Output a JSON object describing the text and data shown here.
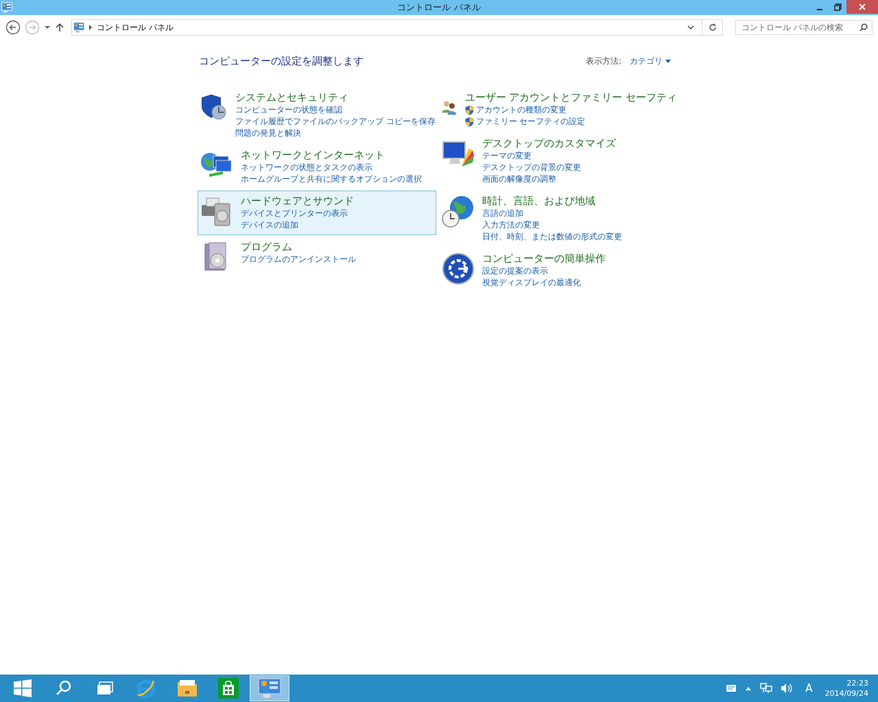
{
  "window": {
    "title": "コントロール パネル"
  },
  "address_bar": {
    "path": "コントロール パネル"
  },
  "search": {
    "placeholder": "コントロール パネルの検索"
  },
  "heading": "コンピューターの設定を調整します",
  "view_by": {
    "label": "表示方法:",
    "value": "カテゴリ"
  },
  "columns": [
    {
      "categories": [
        {
          "kind": "security",
          "title": "システムとセキュリティ",
          "highlighted": false,
          "links": [
            {
              "text": "コンピューターの状態を確認",
              "shield": false
            },
            {
              "text": "ファイル履歴でファイルのバックアップ コピーを保存",
              "shield": false
            },
            {
              "text": "問題の発見と解決",
              "shield": false
            }
          ]
        },
        {
          "kind": "network",
          "title": "ネットワークとインターネット",
          "highlighted": false,
          "links": [
            {
              "text": "ネットワークの状態とタスクの表示",
              "shield": false
            },
            {
              "text": "ホームグループと共有に関するオプションの選択",
              "shield": false
            }
          ]
        },
        {
          "kind": "hardware",
          "title": "ハードウェアとサウンド",
          "highlighted": true,
          "links": [
            {
              "text": "デバイスとプリンターの表示",
              "shield": false
            },
            {
              "text": "デバイスの追加",
              "shield": false
            }
          ]
        },
        {
          "kind": "programs",
          "title": "プログラム",
          "highlighted": false,
          "links": [
            {
              "text": "プログラムのアンインストール",
              "shield": false
            }
          ]
        }
      ]
    },
    {
      "categories": [
        {
          "kind": "users",
          "title": "ユーザー アカウントとファミリー セーフティ",
          "highlighted": false,
          "links": [
            {
              "text": "アカウントの種類の変更",
              "shield": true
            },
            {
              "text": "ファミリー セーフティの設定",
              "shield": true
            }
          ]
        },
        {
          "kind": "appearance",
          "title": "デスクトップのカスタマイズ",
          "highlighted": false,
          "links": [
            {
              "text": "テーマの変更",
              "shield": false
            },
            {
              "text": "デスクトップの背景の変更",
              "shield": false
            },
            {
              "text": "画面の解像度の調整",
              "shield": false
            }
          ]
        },
        {
          "kind": "clock",
          "title": "時計、言語、および地域",
          "highlighted": false,
          "links": [
            {
              "text": "言語の追加",
              "shield": false
            },
            {
              "text": "入力方法の変更",
              "shield": false
            },
            {
              "text": "日付、時刻、または数値の形式の変更",
              "shield": false
            }
          ]
        },
        {
          "kind": "ease",
          "title": "コンピューターの簡単操作",
          "highlighted": false,
          "links": [
            {
              "text": "設定の提案の表示",
              "shield": false
            },
            {
              "text": "視覚ディスプレイの最適化",
              "shield": false
            }
          ]
        }
      ]
    }
  ],
  "taskbar": {
    "buttons": [
      {
        "kind": "start",
        "selected": false
      },
      {
        "kind": "search",
        "selected": false
      },
      {
        "kind": "taskview",
        "selected": false
      },
      {
        "kind": "browser",
        "selected": false
      },
      {
        "kind": "explorer",
        "selected": false
      },
      {
        "kind": "store",
        "selected": false
      },
      {
        "kind": "controlpanel",
        "selected": true
      }
    ],
    "ime": "A",
    "time": "22:23",
    "date": "2014/09/24"
  }
}
